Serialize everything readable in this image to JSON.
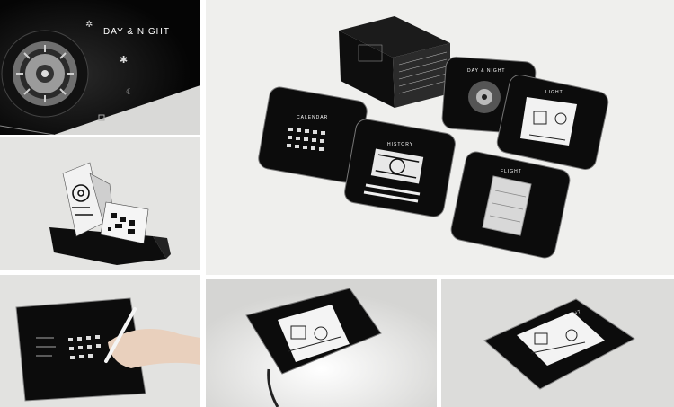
{
  "photos": [
    {
      "id": "closeup",
      "title": "DAY & NIGHT"
    },
    {
      "id": "popup-book"
    },
    {
      "id": "collection"
    },
    {
      "id": "drawing"
    },
    {
      "id": "lightbox"
    },
    {
      "id": "light-card"
    }
  ],
  "card_labels": {
    "day_night": "DAY & NIGHT",
    "light": "LIGHT",
    "calendar": "CALENDAR",
    "history": "HISTORY",
    "flight": "FLIGHT"
  }
}
